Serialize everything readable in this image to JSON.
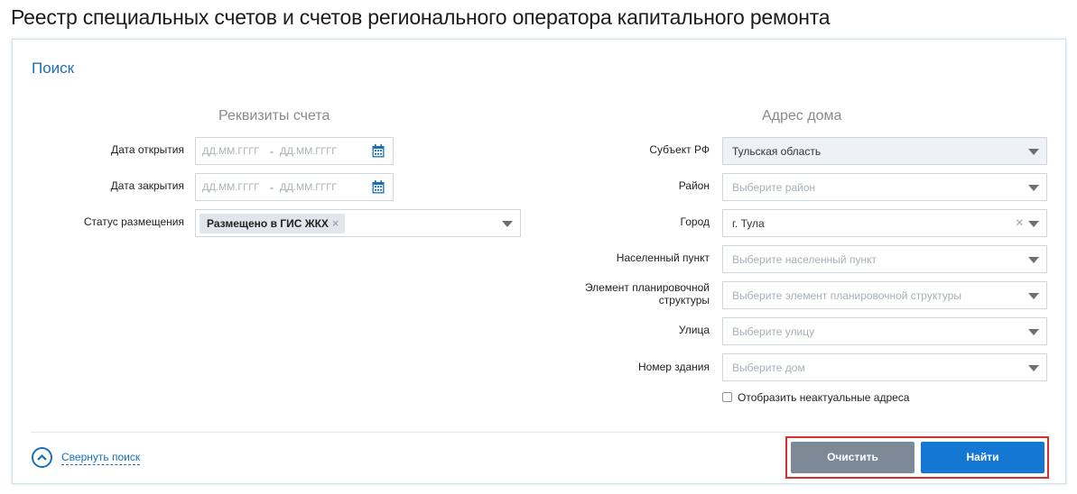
{
  "page": {
    "title": "Реестр специальных счетов и счетов регионального оператора капитального ремонта"
  },
  "panel": {
    "title": "Поиск"
  },
  "account_section": {
    "title": "Реквизиты счета",
    "open_date": {
      "label": "Дата открытия",
      "from_placeholder": "ДД.ММ.ГГГГ",
      "separator": "-",
      "to_placeholder": "ДД.ММ.ГГГГ"
    },
    "close_date": {
      "label": "Дата закрытия",
      "from_placeholder": "ДД.ММ.ГГГГ",
      "separator": "-",
      "to_placeholder": "ДД.ММ.ГГГГ"
    },
    "status": {
      "label": "Статус размещения",
      "tag": "Размещено в ГИС ЖКХ",
      "tag_remove": "×"
    }
  },
  "address_section": {
    "title": "Адрес дома",
    "subject": {
      "label": "Субъект РФ",
      "value": "Тульская область"
    },
    "district": {
      "label": "Район",
      "placeholder": "Выберите район"
    },
    "city": {
      "label": "Город",
      "value": "г. Тула",
      "clear": "×"
    },
    "settlement": {
      "label": "Населенный пункт",
      "placeholder": "Выберите населенный пункт"
    },
    "planning_element": {
      "label_line1": "Элемент планировочной",
      "label_line2": "структуры",
      "placeholder": "Выберите элемент планировочной структуры"
    },
    "street": {
      "label": "Улица",
      "placeholder": "Выберите улицу"
    },
    "building": {
      "label": "Номер здания",
      "placeholder": "Выберите дом"
    },
    "show_inactive": {
      "label": "Отобразить неактуальные адреса",
      "checked": false
    }
  },
  "footer": {
    "collapse_label": "Свернуть поиск",
    "clear_button": "Очистить",
    "find_button": "Найти"
  },
  "colors": {
    "accent": "#1a6fb5",
    "primary_button": "#1577d4",
    "secondary_button": "#7b8a96",
    "highlight_frame": "#d62f2f"
  }
}
